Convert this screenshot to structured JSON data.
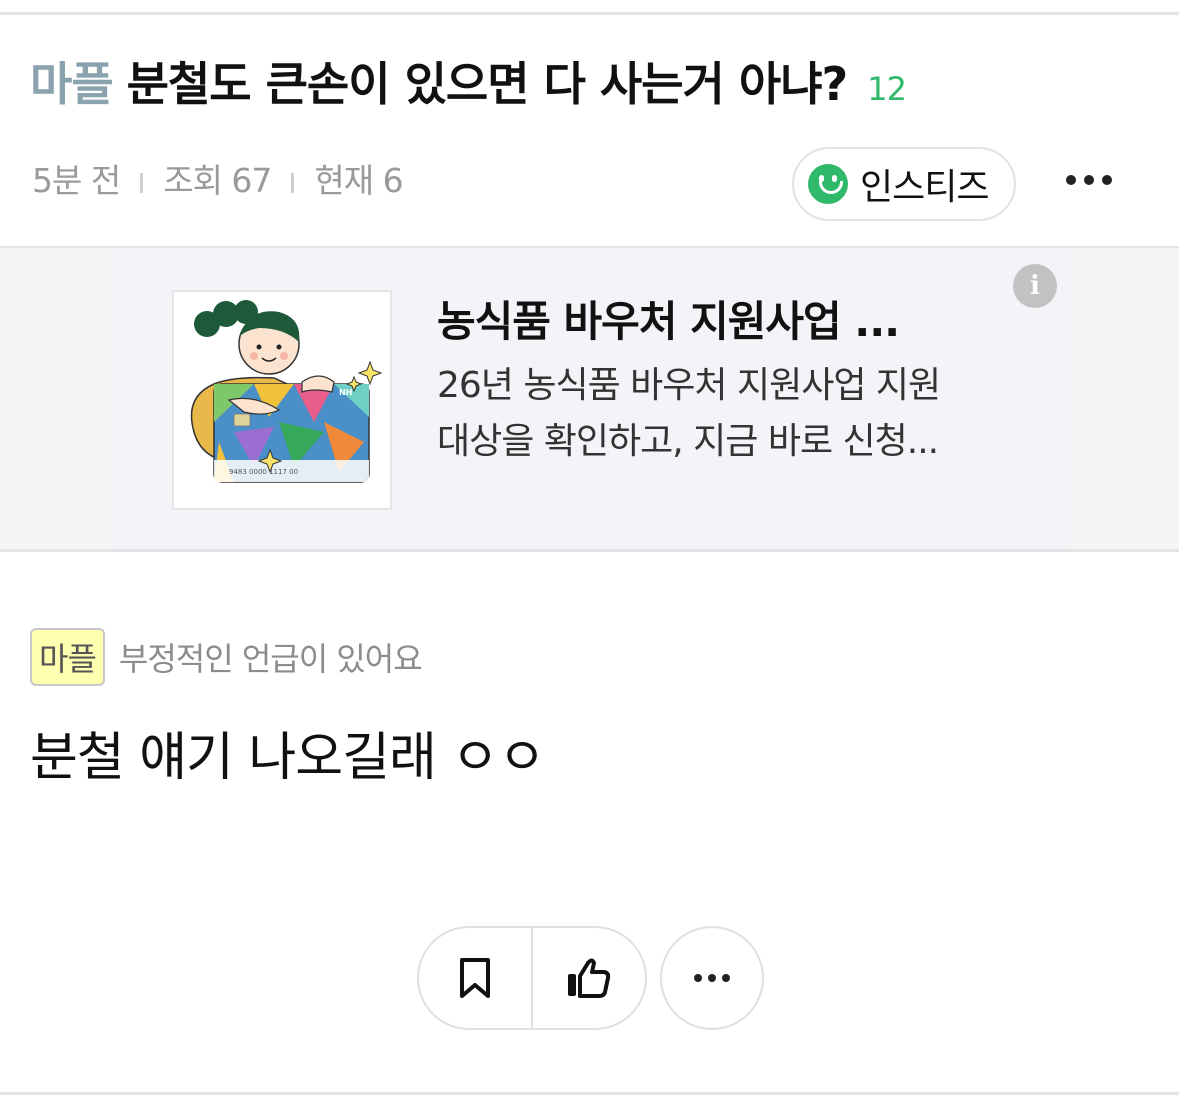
{
  "post": {
    "category": "마플",
    "title": "분철도 큰손이 있으면 다 사는거 아냐?",
    "comment_count": "12",
    "time": "5분 전",
    "views": "조회 67",
    "current": "현재 6",
    "author": "인스티즈"
  },
  "ad": {
    "title": "농식품 바우처 지원사업 ...",
    "desc_line1": "26년 농식품 바우처 지원사업 지원",
    "desc_line2": "대상을 확인하고, 지금 바로 신청...",
    "info_glyph": "i",
    "card_brand": "NH",
    "card_number": "9483 0000 1117 00"
  },
  "content": {
    "badge": "마플",
    "badge_note": "부정적인 언급이 있어요",
    "body": "분철 얘기 나오길래 ㅇㅇ"
  },
  "icons": {
    "author": "smiley-icon",
    "header_more": "more-dots-icon",
    "bookmark": "bookmark-icon",
    "like": "thumbs-up-icon",
    "more": "more-dots-icon",
    "info": "info-icon"
  },
  "colors": {
    "category": "#8aa3ae",
    "comment_count": "#2fb96a",
    "author_icon": "#2fb96a",
    "badge_bg": "#ffffb0"
  }
}
